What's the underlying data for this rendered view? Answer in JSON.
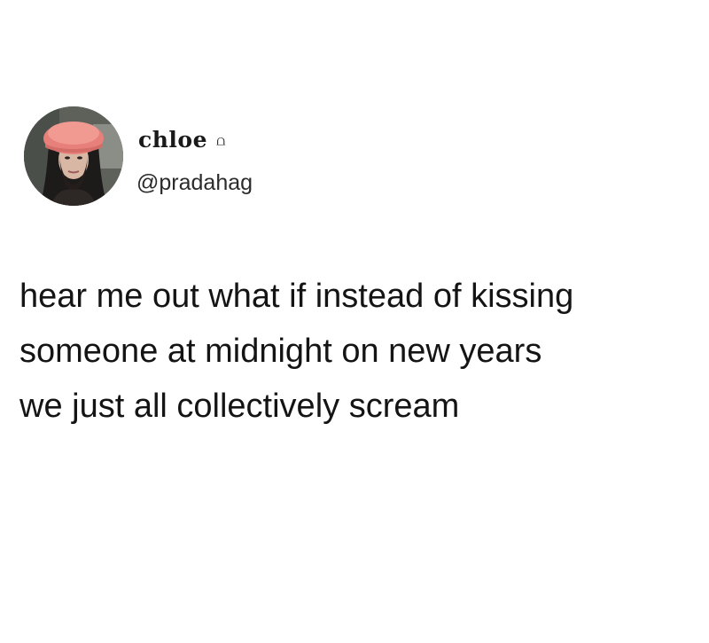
{
  "tweet": {
    "author": {
      "display_name": "chloe",
      "name_badge": "⩍",
      "handle": "@pradahag",
      "avatar_icon": "profile-photo-woman-pink-hat"
    },
    "text_lines": [
      "hear me out what if instead of kissing",
      "someone at midnight on new years",
      "we just all collectively scream"
    ]
  }
}
